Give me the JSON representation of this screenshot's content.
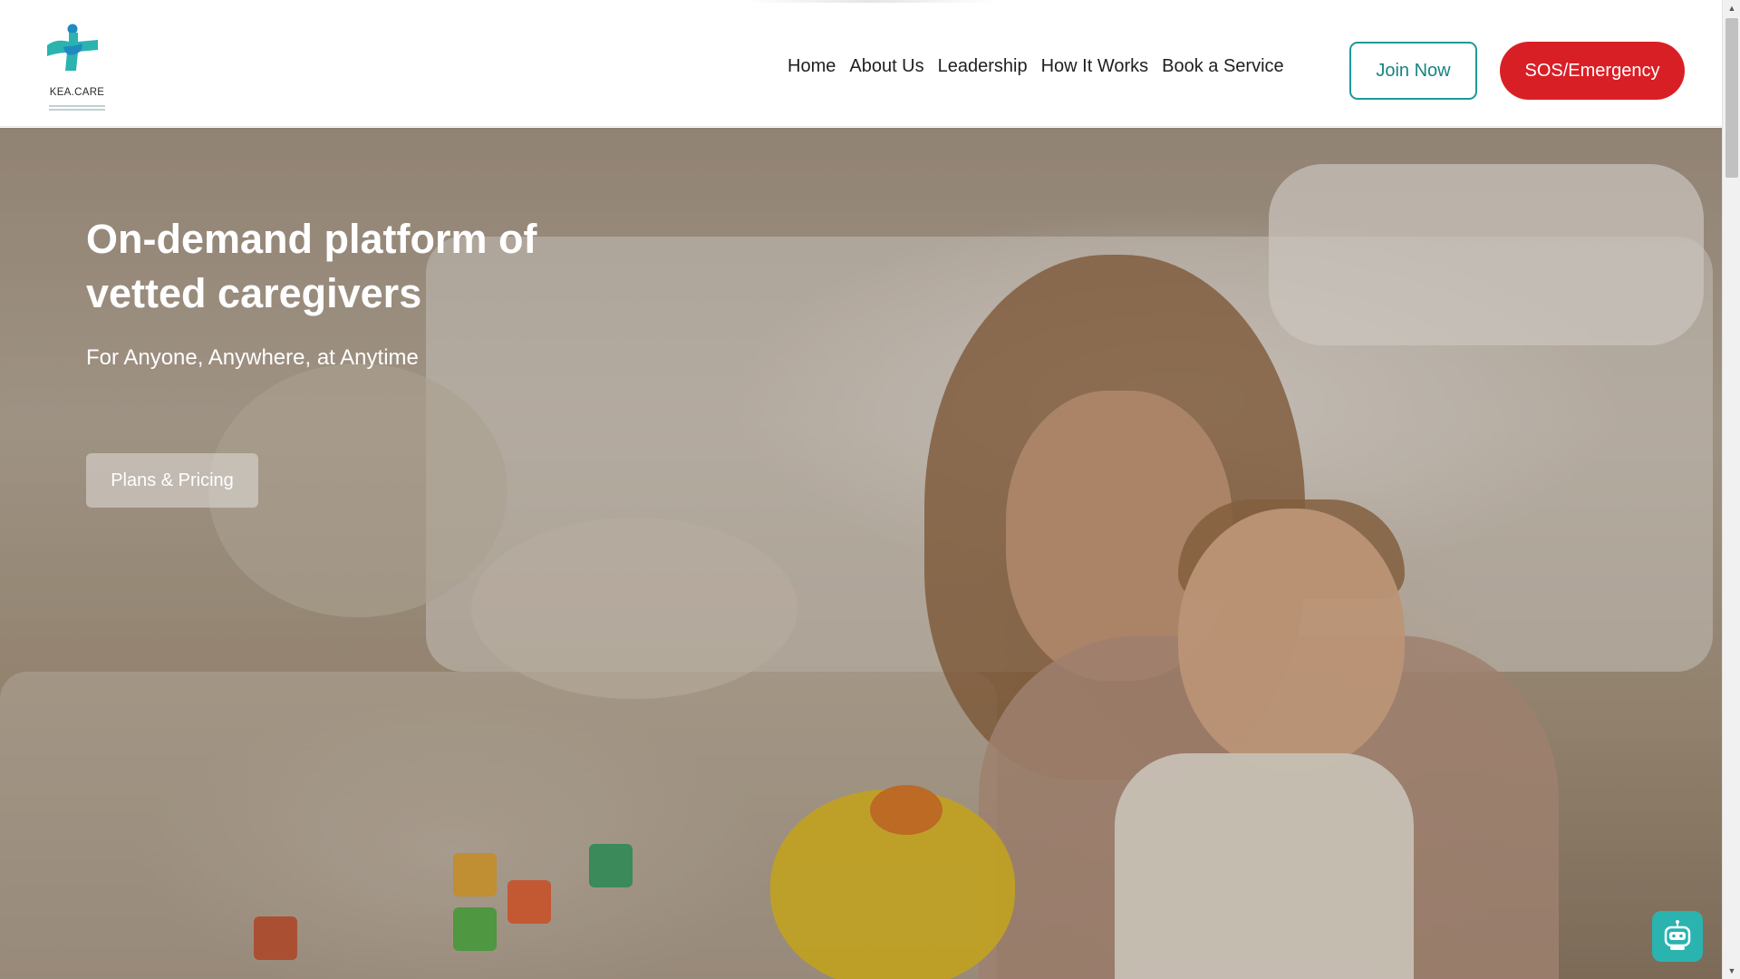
{
  "header": {
    "logo": {
      "name": "KEA.CARE",
      "icon": "plus-figure-logo",
      "colors": {
        "teal": "#2bb3b0",
        "blue": "#1f8ac0"
      }
    },
    "nav": [
      {
        "label": "Home"
      },
      {
        "label": "About Us"
      },
      {
        "label": "Leadership"
      },
      {
        "label": "How It Works"
      },
      {
        "label": "Book a Service"
      }
    ],
    "join_label": "Join Now",
    "sos_label": "SOS/Emergency"
  },
  "hero": {
    "title": "On-demand platform of vetted caregivers",
    "subtitle": "For Anyone, Anywhere, at Anytime",
    "cta_label": "Plans & Pricing",
    "image": "woman-playing-with-toddler-in-bedroom"
  },
  "widgets": {
    "chatbot_icon": "robot-icon"
  },
  "colors": {
    "accent_teal": "#1d9a96",
    "emergency_red": "#d91f26"
  }
}
